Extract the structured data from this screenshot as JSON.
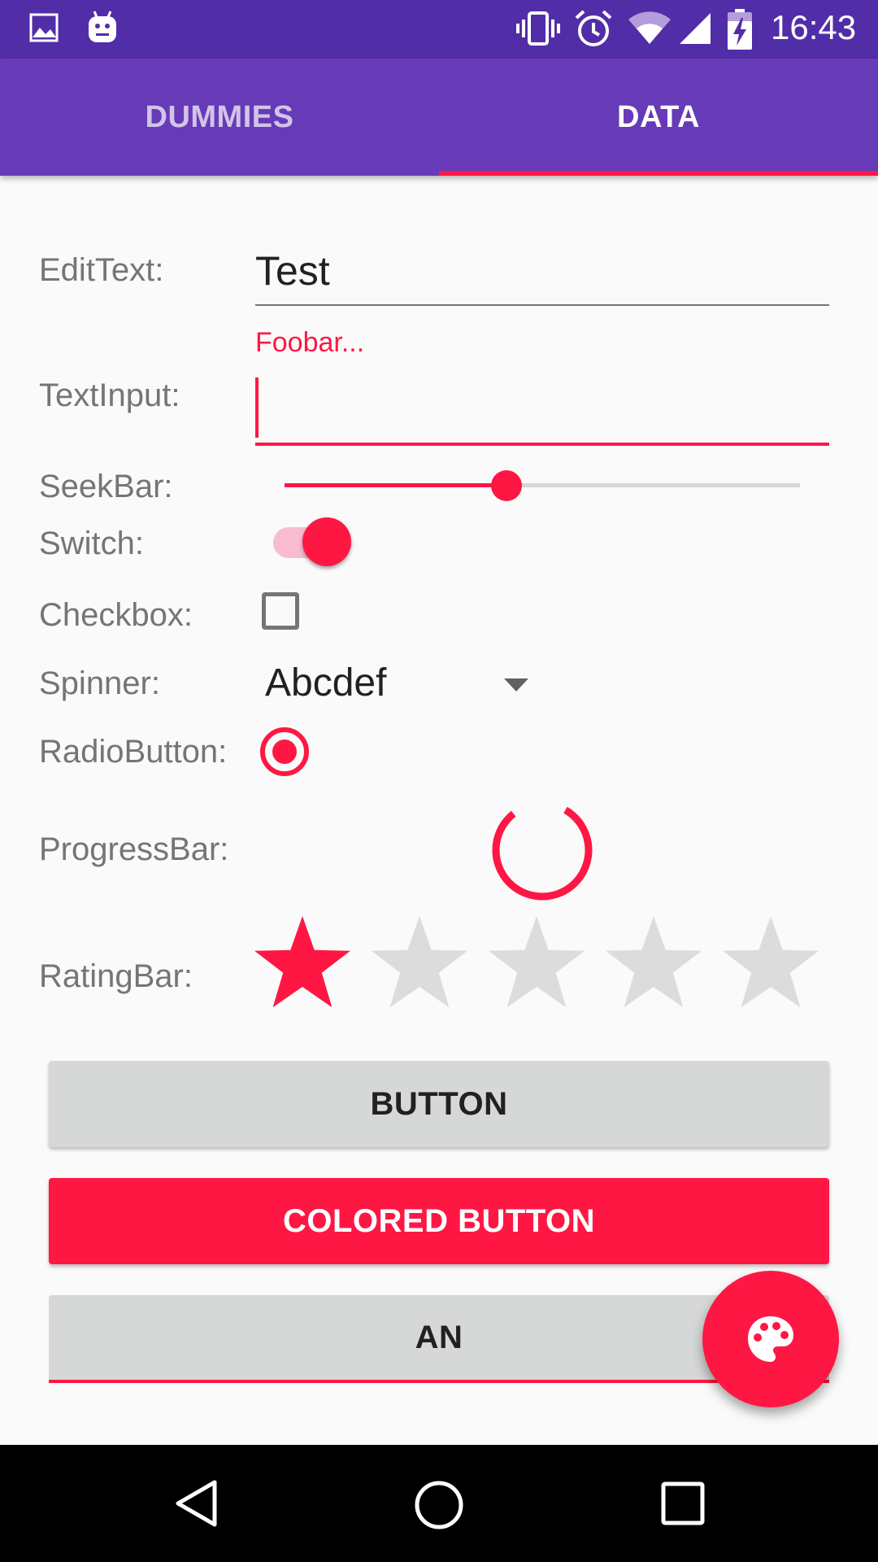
{
  "status_bar": {
    "time": "16:43",
    "left_icons": [
      "image-icon",
      "android-icon"
    ],
    "right_icons": [
      "vibrate-icon",
      "alarm-icon",
      "wifi-icon",
      "signal-icon",
      "battery-charging-icon"
    ]
  },
  "tabs": [
    {
      "label": "DUMMIES",
      "selected": false
    },
    {
      "label": "DATA",
      "selected": true
    }
  ],
  "form": {
    "edittext_label": "EditText:",
    "edittext_value": "Test",
    "textinput_label": "TextInput:",
    "textinput_hint": "Foobar...",
    "textinput_value": "",
    "seekbar_label": "SeekBar:",
    "seekbar_progress": 0.43,
    "switch_label": "Switch:",
    "switch_on": true,
    "checkbox_label": "Checkbox:",
    "checkbox_checked": false,
    "spinner_label": "Spinner:",
    "spinner_value": "Abcdef",
    "radio_label": "RadioButton:",
    "radio_checked": true,
    "progress_label": "ProgressBar:",
    "rating_label": "RatingBar:",
    "rating_value": 1,
    "rating_max": 5
  },
  "buttons": {
    "button_label": "BUTTON",
    "colored_button_label": "COLORED BUTTON",
    "third_button_label": "AN"
  },
  "fab": {
    "icon": "palette-icon"
  },
  "nav_bar": {
    "icons": [
      "back-icon",
      "home-icon",
      "recents-icon"
    ]
  },
  "colors": {
    "primary": "#673ab7",
    "primary_dark": "#512da8",
    "accent": "#ff1744",
    "tab_inactive_text": "#d1c4e9",
    "button_gray": "#d6d7d7"
  }
}
